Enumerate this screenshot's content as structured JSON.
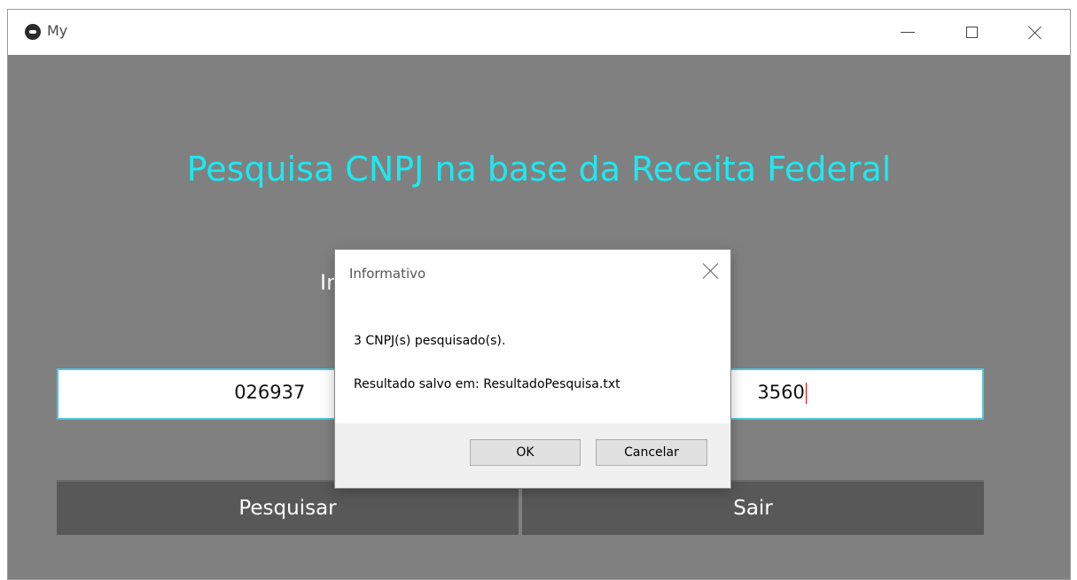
{
  "window": {
    "title": "My",
    "controls": [
      "minimize-icon",
      "maximize-icon",
      "close-icon"
    ]
  },
  "main": {
    "heading": "Pesquisa CNPJ na base da Receita Federal",
    "prompt_partial": "In",
    "input_left_visible": "026937",
    "input_right_visible": "3560",
    "search_button": "Pesquisar",
    "exit_button": "Sair"
  },
  "dialog": {
    "title": "Informativo",
    "message_line1": "3 CNPJ(s) pesquisado(s).",
    "message_line2": "Resultado salvo em: ResultadoPesquisa.txt",
    "ok_label": "OK",
    "cancel_label": "Cancelar"
  },
  "colors": {
    "window_bg": "#808080",
    "heading": "#1ee8f0",
    "button_bg": "#585858",
    "input_border": "#4fc6dc"
  }
}
